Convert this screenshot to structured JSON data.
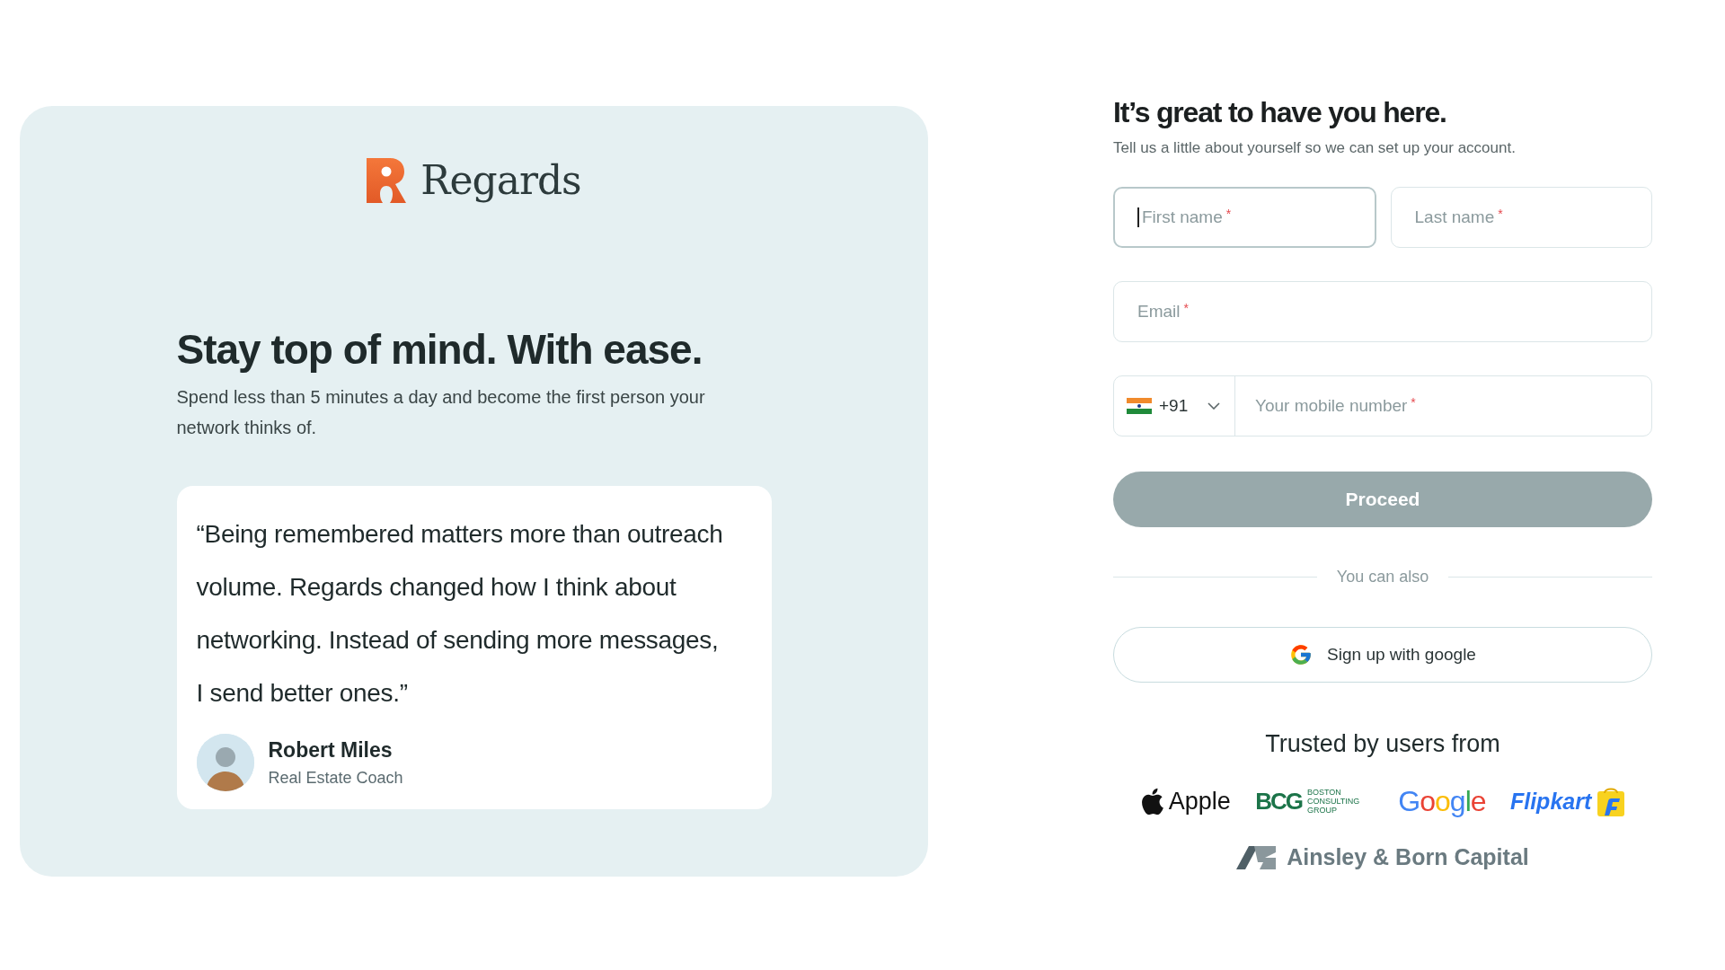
{
  "brand": {
    "name": "Regards"
  },
  "hero": {
    "headline": "Stay top of mind. With ease.",
    "subtext": "Spend less than 5 minutes a day and become the first person your network thinks of."
  },
  "testimonial": {
    "quote": "“Being remembered matters more than outreach volume. Regards changed how I think about networking. Instead of sending more messages, I send better ones.”",
    "author": "Robert Miles",
    "role": "Real Estate Coach"
  },
  "form": {
    "title": "It’s great to have you here.",
    "subtitle": "Tell us a little about yourself so we can set up your account.",
    "fields": [
      {
        "placeholder": "First name",
        "required_mark": "*",
        "focused": true
      },
      {
        "placeholder": "Last name",
        "required_mark": "*",
        "focused": false
      },
      {
        "placeholder": "Email",
        "required_mark": "*",
        "focused": false
      }
    ],
    "phone": {
      "country_code": "+91",
      "placeholder": "Your mobile number",
      "required_mark": "*"
    },
    "proceed": {
      "label": "Proceed",
      "disabled": true
    },
    "divider": "You can also",
    "google_button": "Sign up with google",
    "trusted_title": "Trusted by users from",
    "logos": [
      {
        "kind": "apple",
        "name": "Apple"
      },
      {
        "kind": "bcg",
        "name": "BCG",
        "sub": "BOSTON CONSULTING GROUP"
      },
      {
        "kind": "google",
        "name": "Google"
      },
      {
        "kind": "flipkart",
        "name": "Flipkart"
      },
      {
        "kind": "ainsley",
        "name": "Ainsley & Born Capital"
      }
    ]
  }
}
